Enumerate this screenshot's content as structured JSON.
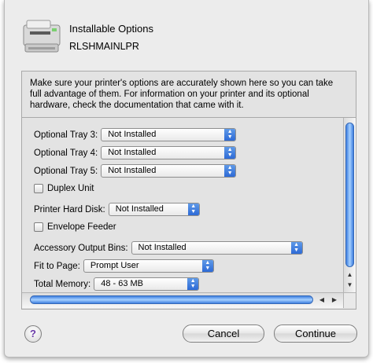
{
  "dialog": {
    "title": "Installable Options",
    "printer_name": "RLSHMAINLPR",
    "printer_icon": "laser-printer-icon"
  },
  "info_text": "Make sure your printer's options are accurately shown here so you can take full advantage of them.  For information on your printer and its optional hardware, check the documentation that came with it.",
  "options": {
    "tray3": {
      "label": "Optional Tray 3:",
      "value": "Not Installed"
    },
    "tray4": {
      "label": "Optional Tray 4:",
      "value": "Not Installed"
    },
    "tray5": {
      "label": "Optional Tray 5:",
      "value": "Not Installed"
    },
    "duplex": {
      "label": "Duplex Unit",
      "checked": false
    },
    "hard_disk": {
      "label": "Printer Hard Disk:",
      "value": "Not Installed"
    },
    "envelope": {
      "label": "Envelope Feeder",
      "checked": false
    },
    "output_bins": {
      "label": "Accessory Output Bins:",
      "value": "Not Installed"
    },
    "fit_to_page": {
      "label": "Fit to Page:",
      "value": "Prompt User"
    },
    "memory": {
      "label": "Total Memory:",
      "value": "48 - 63 MB"
    }
  },
  "buttons": {
    "help": "?",
    "cancel": "Cancel",
    "continue": "Continue"
  },
  "colors": {
    "accent": "#3e7fe0",
    "sheet_bg": "#ececec"
  }
}
